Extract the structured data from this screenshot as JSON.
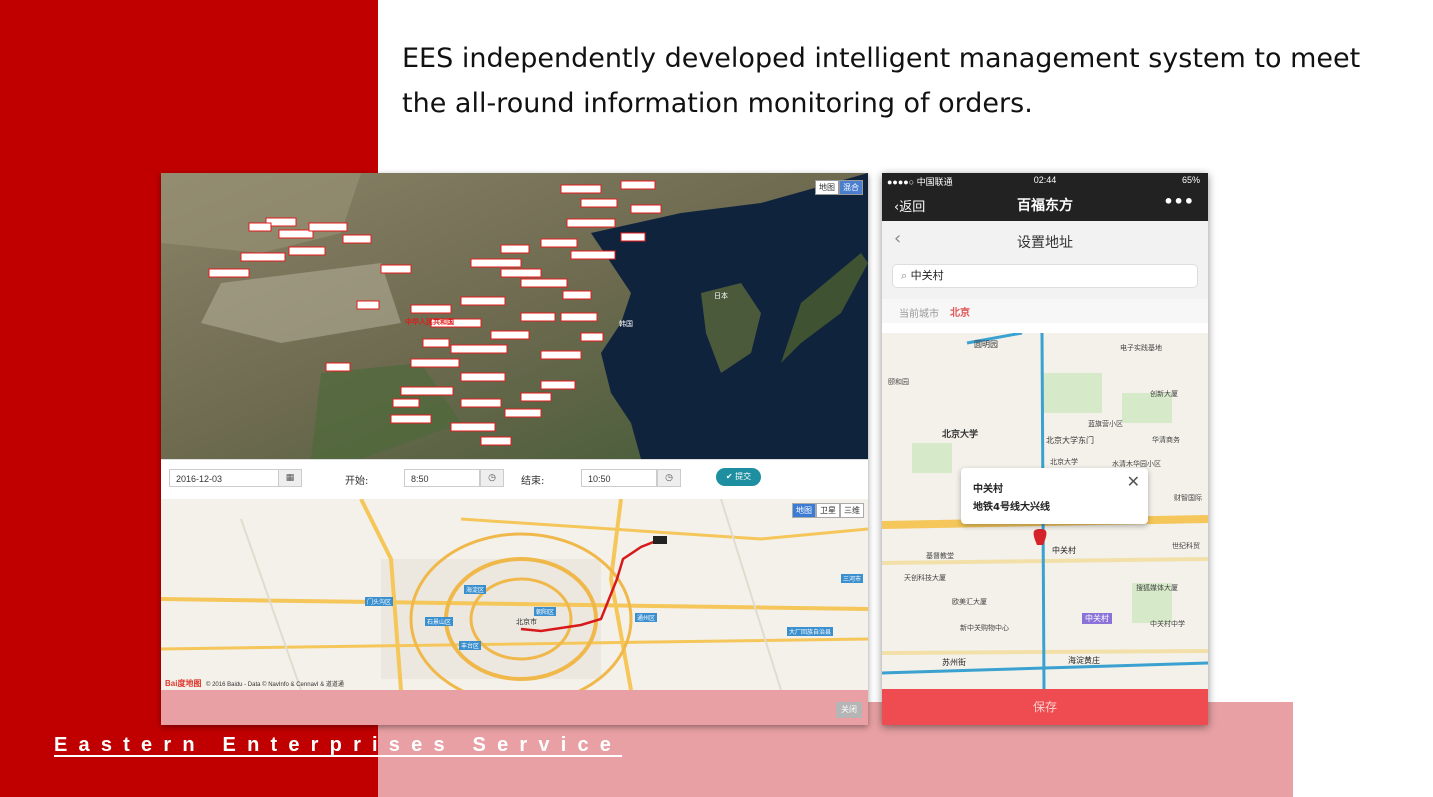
{
  "slide": {
    "headline": "EES independently developed intelligent management system to meet the all-round information monitoring of orders.",
    "footer": "Eastern Enterprises Service"
  },
  "colors": {
    "red": "#c00000",
    "pink": "#e8a0a4",
    "teal": "#1e8fa0",
    "save": "#ee4c51"
  },
  "desktop": {
    "sat_toggle": [
      "地图",
      "混合"
    ],
    "china_label": "中华人民共和国",
    "korea_label": "韩国",
    "japan_label": "日本",
    "date_value": "2016-12-03",
    "start_label": "开始:",
    "start_value": "8:50",
    "end_label": "结束:",
    "end_value": "10:50",
    "submit_label": "✔ 提交",
    "map_tabs": [
      "地图",
      "卫星",
      "三维"
    ],
    "city_label": "北京市",
    "districts": [
      "海淀区",
      "朝阳区",
      "门头沟区",
      "石景山区",
      "丰台区",
      "通州区",
      "大厂回族自治县",
      "三河市"
    ],
    "copyright": "© 2016 Baidu - Data © NavInfo & CennavI & 道道通",
    "baidu_logo": "Bai度地图",
    "close_label": "关闭"
  },
  "phone": {
    "carrier": "●●●●○ 中国联通",
    "time": "02:44",
    "battery": "65%",
    "back_label": "返回",
    "title": "百福东方",
    "more": "•••",
    "subtitle": "设置地址",
    "search_value": "中关村",
    "city_prefix": "当前城市",
    "city_name": "北京",
    "map_places": [
      "圆明园",
      "电子实践基地",
      "颐和园",
      "北京大学",
      "北京大学东门",
      "蓝旗营小区",
      "华清商务",
      "北京大学",
      "水清木华园小区",
      "创新大厦",
      "中关村",
      "基督教堂",
      "天创科技大厦",
      "欧美汇大厦",
      "新中关购物中心",
      "中关村",
      "海淀黄庄",
      "苏州街",
      "搜狐媒体大厦",
      "中关村中学",
      "财智国际",
      "世纪科贸"
    ],
    "popup_title": "中关村",
    "popup_line": "地铁4号线大兴线",
    "save_label": "保存"
  }
}
